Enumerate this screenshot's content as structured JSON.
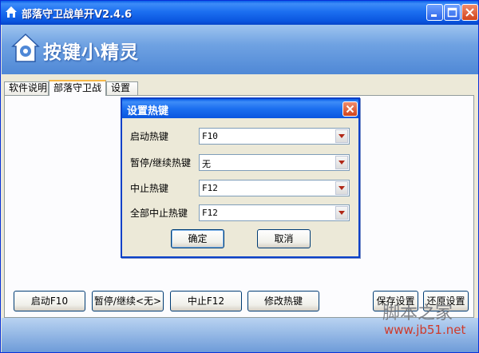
{
  "window": {
    "title": "部落守卫战单开V2.4.6",
    "banner_text": "按键小精灵"
  },
  "tabs": [
    {
      "label": "软件说明"
    },
    {
      "label": "部落守卫战"
    },
    {
      "label": "设置"
    }
  ],
  "dialog": {
    "title": "设置热键",
    "rows": [
      {
        "label": "启动热键",
        "value": "F10"
      },
      {
        "label": "暂停/继续热键",
        "value": "无"
      },
      {
        "label": "中止热键",
        "value": "F12"
      },
      {
        "label": "全部中止热键",
        "value": "F12"
      }
    ],
    "ok_label": "确定",
    "cancel_label": "取消"
  },
  "buttons": {
    "start": "启动F10",
    "pause": "暂停/继续<无>",
    "stop": "中止F12",
    "edit_hotkeys": "修改热键",
    "save": "保存设置",
    "restore": "还原设置"
  },
  "watermark": {
    "line1": "脚本之家",
    "line2": "www.jb51.net"
  },
  "colors": {
    "titlebar": "#0a56df",
    "close": "#d2441c",
    "banner": "#6fa2e2"
  }
}
